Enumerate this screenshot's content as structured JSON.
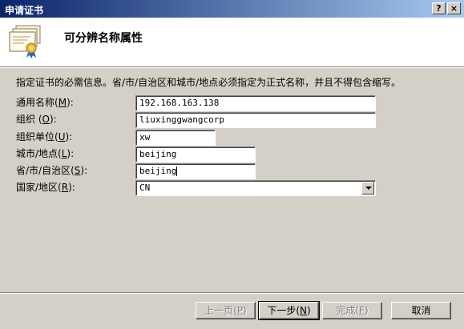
{
  "window": {
    "title": "申请证书",
    "help_label": "?",
    "close_label": "×"
  },
  "header": {
    "title": "可分辨名称属性",
    "icon": "certificate-icon"
  },
  "instruction": "指定证书的必需信息。省/市/自治区和城市/地点必须指定为正式名称，并且不得包含缩写。",
  "fields": [
    {
      "label": "通用名称",
      "accel": "M",
      "value": "192.168.163.138"
    },
    {
      "label": "组织",
      "accel": "O",
      "value": "liuxinggwangcorp"
    },
    {
      "label": "组织单位",
      "accel": "U",
      "value": "xw"
    },
    {
      "label": "城市/地点",
      "accel": "L",
      "value": "beijing"
    },
    {
      "label": "省/市/自治区",
      "accel": "S",
      "value": "beijing"
    },
    {
      "label": "国家/地区",
      "accel": "R",
      "value": "CN"
    }
  ],
  "buttons": {
    "back": {
      "label": "上一页",
      "accel": "P",
      "enabled": false
    },
    "next": {
      "label": "下一步",
      "accel": "N",
      "enabled": true
    },
    "finish": {
      "label": "完成",
      "accel": "F",
      "enabled": false
    },
    "cancel": {
      "label": "取消"
    }
  },
  "colors": {
    "titlebar_start": "#0a246a",
    "titlebar_end": "#a6caf0",
    "dialog_face": "#d4d0c8"
  }
}
